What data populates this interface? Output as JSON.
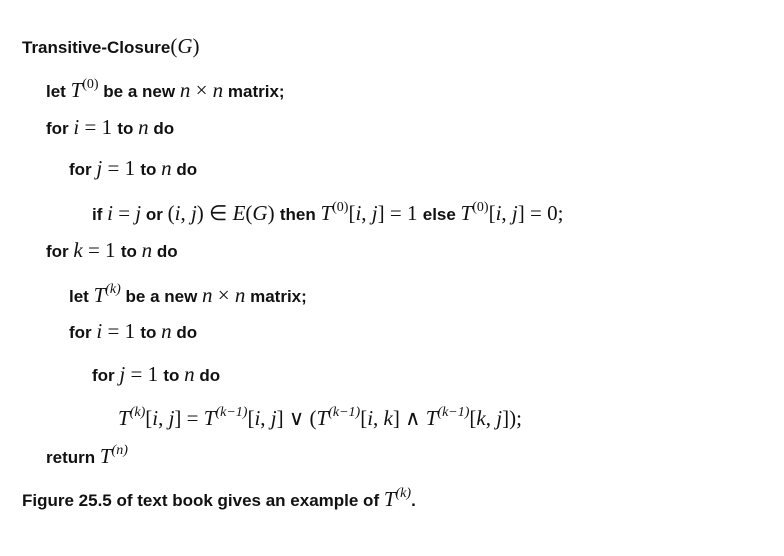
{
  "lines": [
    {
      "indent": 0,
      "parts": [
        {
          "t": "kw",
          "v": "Transitive-Closure"
        },
        {
          "t": "r",
          "v": "("
        },
        {
          "t": "m",
          "v": "G"
        },
        {
          "t": "r",
          "v": ")"
        }
      ]
    },
    {
      "indent": 1,
      "parts": [
        {
          "t": "kw",
          "v": "let "
        },
        {
          "t": "m",
          "v": "T"
        },
        {
          "t": "sup",
          "v": "(0)"
        },
        {
          "t": "kw",
          "v": " be a new "
        },
        {
          "t": "m",
          "v": "n"
        },
        {
          "t": "r",
          "v": " × "
        },
        {
          "t": "m",
          "v": "n"
        },
        {
          "t": "kw",
          "v": " matrix;"
        }
      ]
    },
    {
      "indent": 1,
      "parts": [
        {
          "t": "kw",
          "v": "for "
        },
        {
          "t": "m",
          "v": "i"
        },
        {
          "t": "r",
          "v": " = 1 "
        },
        {
          "t": "kw",
          "v": "to "
        },
        {
          "t": "m",
          "v": "n"
        },
        {
          "t": "kw",
          "v": " do"
        }
      ]
    },
    {
      "indent": 2,
      "parts": [
        {
          "t": "kw",
          "v": "for "
        },
        {
          "t": "m",
          "v": "j"
        },
        {
          "t": "r",
          "v": " = 1 "
        },
        {
          "t": "kw",
          "v": "to "
        },
        {
          "t": "m",
          "v": "n"
        },
        {
          "t": "kw",
          "v": " do"
        }
      ]
    },
    {
      "indent": 3,
      "parts": [
        {
          "t": "kw",
          "v": "if "
        },
        {
          "t": "m",
          "v": "i"
        },
        {
          "t": "r",
          "v": " = "
        },
        {
          "t": "m",
          "v": "j"
        },
        {
          "t": "kw",
          "v": " or "
        },
        {
          "t": "r",
          "v": "("
        },
        {
          "t": "m",
          "v": "i"
        },
        {
          "t": "r",
          "v": ", "
        },
        {
          "t": "m",
          "v": "j"
        },
        {
          "t": "r",
          "v": ") ∈ "
        },
        {
          "t": "m",
          "v": "E"
        },
        {
          "t": "r",
          "v": "("
        },
        {
          "t": "m",
          "v": "G"
        },
        {
          "t": "r",
          "v": ") "
        },
        {
          "t": "kw",
          "v": "then "
        },
        {
          "t": "m",
          "v": "T"
        },
        {
          "t": "sup",
          "v": "(0)"
        },
        {
          "t": "r",
          "v": "["
        },
        {
          "t": "m",
          "v": "i"
        },
        {
          "t": "r",
          "v": ", "
        },
        {
          "t": "m",
          "v": "j"
        },
        {
          "t": "r",
          "v": "] = 1 "
        },
        {
          "t": "kw",
          "v": "else "
        },
        {
          "t": "m",
          "v": "T"
        },
        {
          "t": "sup",
          "v": "(0)"
        },
        {
          "t": "r",
          "v": "["
        },
        {
          "t": "m",
          "v": "i"
        },
        {
          "t": "r",
          "v": ", "
        },
        {
          "t": "m",
          "v": "j"
        },
        {
          "t": "r",
          "v": "] = 0;"
        }
      ]
    },
    {
      "indent": 1,
      "parts": [
        {
          "t": "kw",
          "v": "for "
        },
        {
          "t": "m",
          "v": "k"
        },
        {
          "t": "r",
          "v": " = 1 "
        },
        {
          "t": "kw",
          "v": "to "
        },
        {
          "t": "m",
          "v": "n"
        },
        {
          "t": "kw",
          "v": " do"
        }
      ]
    },
    {
      "indent": 2,
      "parts": [
        {
          "t": "kw",
          "v": "let "
        },
        {
          "t": "m",
          "v": "T"
        },
        {
          "t": "sup",
          "v": "(k)"
        },
        {
          "t": "kw",
          "v": " be a new "
        },
        {
          "t": "m",
          "v": "n"
        },
        {
          "t": "r",
          "v": " × "
        },
        {
          "t": "m",
          "v": "n"
        },
        {
          "t": "kw",
          "v": " matrix;"
        }
      ]
    },
    {
      "indent": 2,
      "parts": [
        {
          "t": "kw",
          "v": "for "
        },
        {
          "t": "m",
          "v": "i"
        },
        {
          "t": "r",
          "v": " = 1 "
        },
        {
          "t": "kw",
          "v": "to "
        },
        {
          "t": "m",
          "v": "n"
        },
        {
          "t": "kw",
          "v": " do"
        }
      ]
    },
    {
      "indent": 3,
      "parts": [
        {
          "t": "kw",
          "v": "for "
        },
        {
          "t": "m",
          "v": "j"
        },
        {
          "t": "r",
          "v": " = 1 "
        },
        {
          "t": "kw",
          "v": "to "
        },
        {
          "t": "m",
          "v": "n"
        },
        {
          "t": "kw",
          "v": " do"
        }
      ]
    },
    {
      "indent": 4,
      "parts": [
        {
          "t": "m",
          "v": "T"
        },
        {
          "t": "sup",
          "v": "(k)"
        },
        {
          "t": "r",
          "v": "["
        },
        {
          "t": "m",
          "v": "i"
        },
        {
          "t": "r",
          "v": ", "
        },
        {
          "t": "m",
          "v": "j"
        },
        {
          "t": "r",
          "v": "] = "
        },
        {
          "t": "m",
          "v": "T"
        },
        {
          "t": "sup",
          "v": "(k−1)"
        },
        {
          "t": "r",
          "v": "["
        },
        {
          "t": "m",
          "v": "i"
        },
        {
          "t": "r",
          "v": ", "
        },
        {
          "t": "m",
          "v": "j"
        },
        {
          "t": "r",
          "v": "] ∨ ("
        },
        {
          "t": "m",
          "v": "T"
        },
        {
          "t": "sup",
          "v": "(k−1)"
        },
        {
          "t": "r",
          "v": "["
        },
        {
          "t": "m",
          "v": "i"
        },
        {
          "t": "r",
          "v": ", "
        },
        {
          "t": "m",
          "v": "k"
        },
        {
          "t": "r",
          "v": "] ∧ "
        },
        {
          "t": "m",
          "v": "T"
        },
        {
          "t": "sup",
          "v": "(k−1)"
        },
        {
          "t": "r",
          "v": "["
        },
        {
          "t": "m",
          "v": "k"
        },
        {
          "t": "r",
          "v": ", "
        },
        {
          "t": "m",
          "v": "j"
        },
        {
          "t": "r",
          "v": "]);"
        }
      ]
    },
    {
      "indent": 1,
      "parts": [
        {
          "t": "kw",
          "v": "return "
        },
        {
          "t": "m",
          "v": "T"
        },
        {
          "t": "sup",
          "v": "(n)"
        }
      ]
    },
    {
      "indent": 0,
      "parts": [
        {
          "t": "kw",
          "v": "Figure 25.5 of text book gives an example of "
        },
        {
          "t": "m",
          "v": "T"
        },
        {
          "t": "sup",
          "v": "(k)"
        },
        {
          "t": "kw",
          "v": "."
        }
      ]
    }
  ]
}
